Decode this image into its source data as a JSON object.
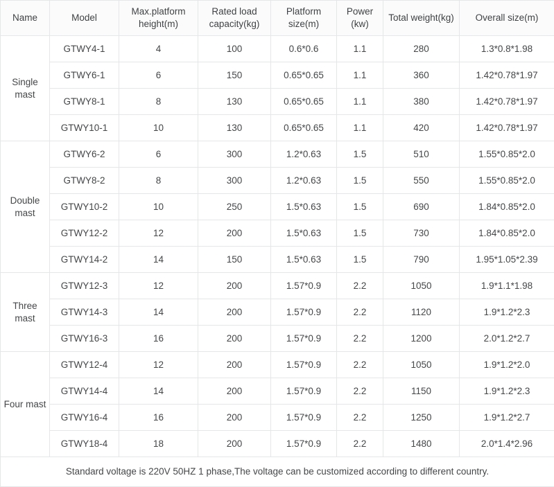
{
  "table": {
    "headers": [
      "Name",
      "Model",
      "Max.platform height(m)",
      "Rated load capacity(kg)",
      "Platform size(m)",
      "Power (kw)",
      "Total weight(kg)",
      "Overall size(m)"
    ],
    "groups": [
      {
        "name": "Single mast",
        "rows": [
          {
            "model": "GTWY4-1",
            "height": "4",
            "load": "100",
            "platform_size": "0.6*0.6",
            "power": "1.1",
            "weight": "280",
            "overall_size": "1.3*0.8*1.98"
          },
          {
            "model": "GTWY6-1",
            "height": "6",
            "load": "150",
            "platform_size": "0.65*0.65",
            "power": "1.1",
            "weight": "360",
            "overall_size": "1.42*0.78*1.97"
          },
          {
            "model": "GTWY8-1",
            "height": "8",
            "load": "130",
            "platform_size": "0.65*0.65",
            "power": "1.1",
            "weight": "380",
            "overall_size": "1.42*0.78*1.97"
          },
          {
            "model": "GTWY10-1",
            "height": "10",
            "load": "130",
            "platform_size": "0.65*0.65",
            "power": "1.1",
            "weight": "420",
            "overall_size": "1.42*0.78*1.97"
          }
        ]
      },
      {
        "name": "Double mast",
        "rows": [
          {
            "model": "GTWY6-2",
            "height": "6",
            "load": "300",
            "platform_size": "1.2*0.63",
            "power": "1.5",
            "weight": "510",
            "overall_size": "1.55*0.85*2.0"
          },
          {
            "model": "GTWY8-2",
            "height": "8",
            "load": "300",
            "platform_size": "1.2*0.63",
            "power": "1.5",
            "weight": "550",
            "overall_size": "1.55*0.85*2.0"
          },
          {
            "model": "GTWY10-2",
            "height": "10",
            "load": "250",
            "platform_size": "1.5*0.63",
            "power": "1.5",
            "weight": "690",
            "overall_size": "1.84*0.85*2.0"
          },
          {
            "model": "GTWY12-2",
            "height": "12",
            "load": "200",
            "platform_size": "1.5*0.63",
            "power": "1.5",
            "weight": "730",
            "overall_size": "1.84*0.85*2.0"
          },
          {
            "model": "GTWY14-2",
            "height": "14",
            "load": "150",
            "platform_size": "1.5*0.63",
            "power": "1.5",
            "weight": "790",
            "overall_size": "1.95*1.05*2.39"
          }
        ]
      },
      {
        "name": "Three mast",
        "rows": [
          {
            "model": "GTWY12-3",
            "height": "12",
            "load": "200",
            "platform_size": "1.57*0.9",
            "power": "2.2",
            "weight": "1050",
            "overall_size": "1.9*1.1*1.98"
          },
          {
            "model": "GTWY14-3",
            "height": "14",
            "load": "200",
            "platform_size": "1.57*0.9",
            "power": "2.2",
            "weight": "1120",
            "overall_size": "1.9*1.2*2.3"
          },
          {
            "model": "GTWY16-3",
            "height": "16",
            "load": "200",
            "platform_size": "1.57*0.9",
            "power": "2.2",
            "weight": "1200",
            "overall_size": "2.0*1.2*2.7"
          }
        ]
      },
      {
        "name": "Four mast",
        "rows": [
          {
            "model": "GTWY12-4",
            "height": "12",
            "load": "200",
            "platform_size": "1.57*0.9",
            "power": "2.2",
            "weight": "1050",
            "overall_size": "1.9*1.2*2.0"
          },
          {
            "model": "GTWY14-4",
            "height": "14",
            "load": "200",
            "platform_size": "1.57*0.9",
            "power": "2.2",
            "weight": "1150",
            "overall_size": "1.9*1.2*2.3"
          },
          {
            "model": "GTWY16-4",
            "height": "16",
            "load": "200",
            "platform_size": "1.57*0.9",
            "power": "2.2",
            "weight": "1250",
            "overall_size": "1.9*1.2*2.7"
          },
          {
            "model": "GTWY18-4",
            "height": "18",
            "load": "200",
            "platform_size": "1.57*0.9",
            "power": "2.2",
            "weight": "1480",
            "overall_size": "2.0*1.4*2.96"
          }
        ]
      }
    ],
    "footer_note": "Standard voltage is 220V 50HZ 1 phase,The voltage can be customized according to different country."
  },
  "colors": {
    "border": "#e4e6e8",
    "header_bg": "#fbfbfb",
    "text": "#444648",
    "cell_bg": "#ffffff"
  }
}
